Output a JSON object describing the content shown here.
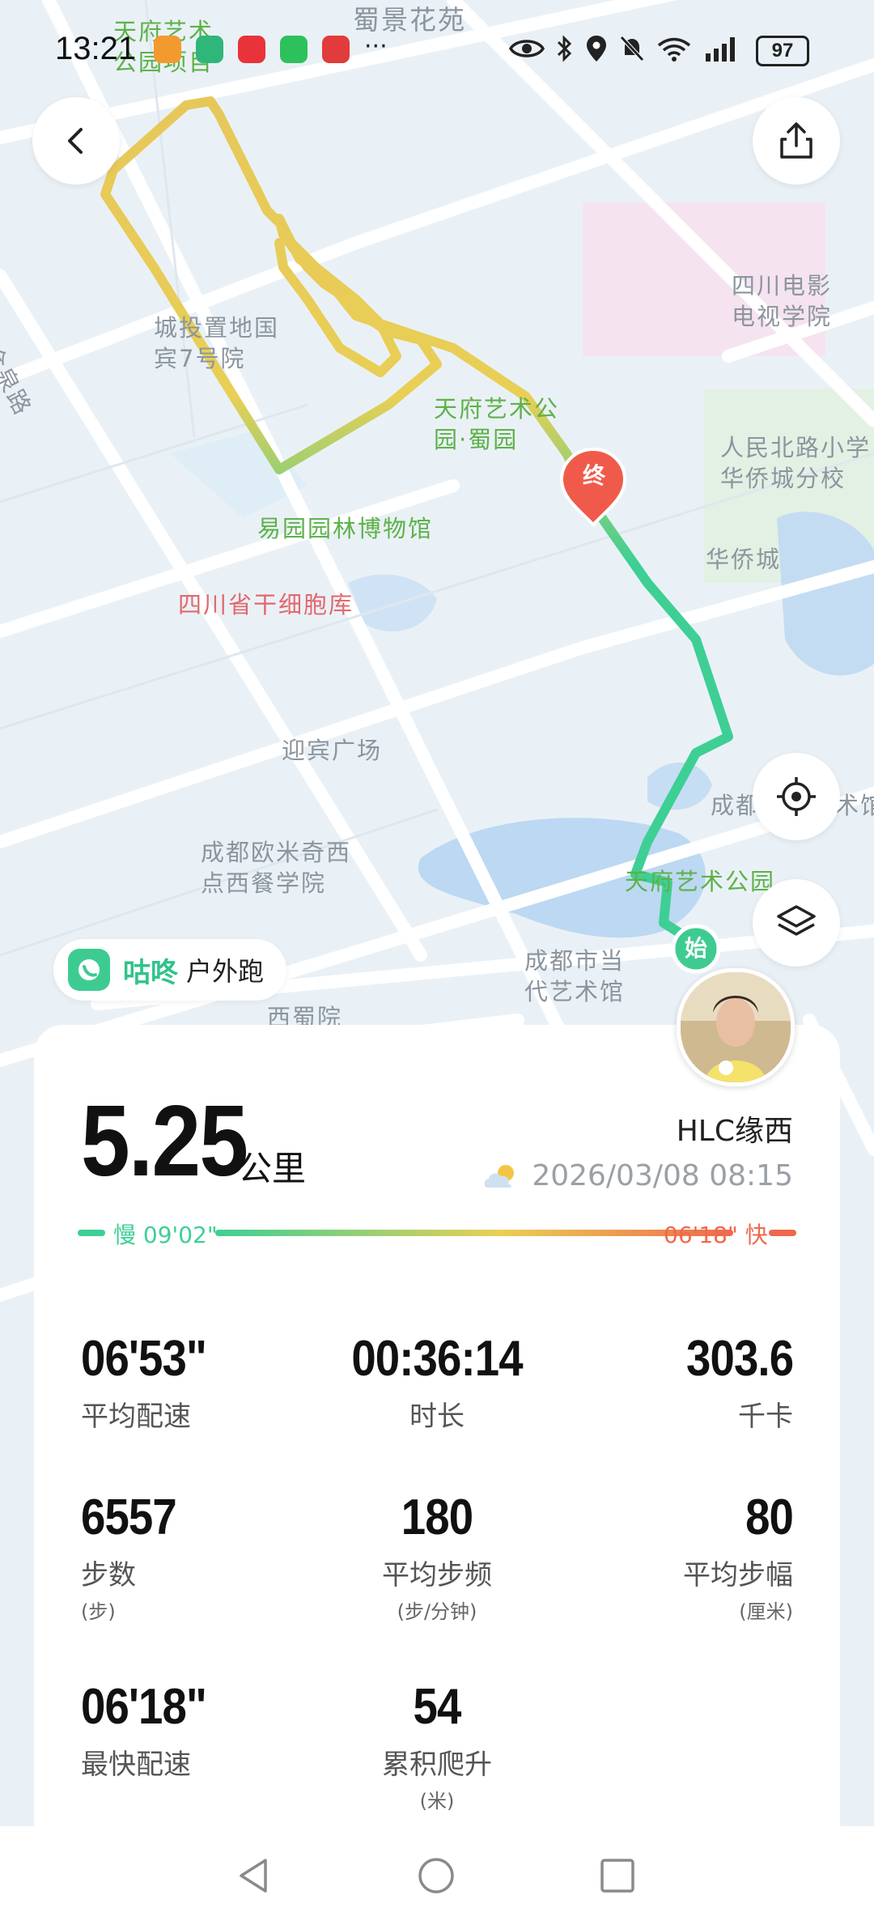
{
  "status_bar": {
    "time": "13:21",
    "battery": "97"
  },
  "map": {
    "labels": [
      {
        "text": "天府艺术\n公园项目",
        "color": "green"
      },
      {
        "text": "蜀景花苑",
        "color": "gray"
      },
      {
        "text": "四川电影\n电视学院",
        "color": "gray"
      },
      {
        "text": "城投置地国\n宾7号院",
        "color": "gray"
      },
      {
        "text": "金泉路",
        "color": "gray"
      },
      {
        "text": "天府艺术公\n园·蜀园",
        "color": "green"
      },
      {
        "text": "人民北路小学\n华侨城分校",
        "color": "gray"
      },
      {
        "text": "易园园林博物馆",
        "color": "green"
      },
      {
        "text": "华侨城",
        "color": "gray"
      },
      {
        "text": "四川省干细胞库",
        "color": "red"
      },
      {
        "text": "迎宾广场",
        "color": "gray"
      },
      {
        "text": "成都欧米奇西\n点西餐学院",
        "color": "gray"
      },
      {
        "text": "天府艺术公园",
        "color": "green"
      },
      {
        "text": "成都市当\n代艺术馆",
        "color": "gray"
      },
      {
        "text": "成都",
        "color": "gray"
      },
      {
        "text": "术馆",
        "color": "gray"
      },
      {
        "text": "西蜀院",
        "color": "gray"
      }
    ],
    "start_marker": "始",
    "end_marker": "终"
  },
  "badge": {
    "brand": "咕咚",
    "sport": "户外跑"
  },
  "summary": {
    "distance": "5.25",
    "distance_unit": "公里",
    "username": "HLC缘西",
    "datetime": "2026/03/08 08:15",
    "weather_icon": "partly-cloudy-icon",
    "pace_slow_label": "慢 09'02\"",
    "pace_fast_label": "06'18\" 快"
  },
  "stats": [
    {
      "value": "06'53\"",
      "label": "平均配速",
      "sub": ""
    },
    {
      "value": "00:36:14",
      "label": "时长",
      "sub": ""
    },
    {
      "value": "303.6",
      "label": "千卡",
      "sub": ""
    },
    {
      "value": "6557",
      "label": "步数",
      "sub": "(步)"
    },
    {
      "value": "180",
      "label": "平均步频",
      "sub": "(步/分钟)"
    },
    {
      "value": "80",
      "label": "平均步幅",
      "sub": "(厘米)"
    },
    {
      "value": "06'18\"",
      "label": "最快配速",
      "sub": ""
    },
    {
      "value": "54",
      "label": "累积爬升",
      "sub": "(米)"
    }
  ],
  "colors": {
    "accent": "#30c38a",
    "route_slow": "#3ecf95",
    "route_mid": "#e9cf55",
    "route_fast": "#f0684c",
    "end_marker": "#f05a4a",
    "start_marker": "#3ecb91"
  }
}
